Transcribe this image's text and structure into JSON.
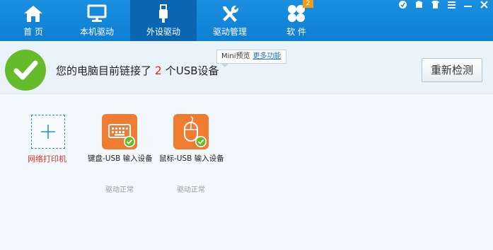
{
  "nav": {
    "items": [
      {
        "label": "首 页",
        "icon": "home-icon"
      },
      {
        "label": "本机驱动",
        "icon": "monitor-icon"
      },
      {
        "label": "外设驱动",
        "icon": "usb-icon"
      },
      {
        "label": "驱动管理",
        "icon": "tools-icon"
      },
      {
        "label": "软 件",
        "icon": "software-icon"
      }
    ],
    "active": "外设驱动",
    "software_badge": "2"
  },
  "status": {
    "prefix": "您的电脑目前链接了",
    "count": "2",
    "suffix": "个USB设备"
  },
  "tooltip": {
    "text": "Mini预览",
    "link": "更多功能"
  },
  "rescan_label": "重新检测",
  "add_printer_label": "网络打印机",
  "devices": [
    {
      "name": "键盘-USB 输入设备",
      "state": "驱动正常",
      "icon": "keyboard-icon"
    },
    {
      "name": "鼠标-USB 输入设备",
      "state": "驱动正常",
      "icon": "mouse-icon"
    }
  ],
  "colors": {
    "nav_bg": "#1286da",
    "nav_active": "#0a66b3",
    "ok_green": "#66bb2a",
    "device_orange": "#f07c32",
    "alert_red": "#d8322a"
  }
}
